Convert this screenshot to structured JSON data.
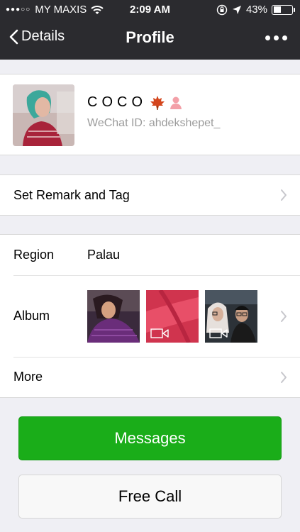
{
  "status": {
    "signal": "●●●○○",
    "carrier": "MY MAXIS",
    "time": "2:09 AM",
    "battery_text": "43%",
    "battery_level": 0.43
  },
  "nav": {
    "back_label": "Details",
    "title": "Profile"
  },
  "profile": {
    "name": "COCO",
    "wechat_id": "WeChat ID: ahdekshepet_"
  },
  "remark": {
    "label": "Set Remark and Tag"
  },
  "info": {
    "region_label": "Region",
    "region_value": "Palau",
    "album_label": "Album",
    "more_label": "More"
  },
  "actions": {
    "messages_label": "Messages",
    "call_label": "Free Call"
  },
  "colors": {
    "nav_bg": "#2b2b2f",
    "accent_green": "#1aad19",
    "page_bg": "#efeff4"
  },
  "icons": [
    "wifi-icon",
    "lock-rotation-icon",
    "location-arrow-icon",
    "battery-icon",
    "back-chevron-icon",
    "more-dots-icon",
    "maple-leaf-icon",
    "female-person-icon",
    "chevron-right-icon",
    "video-icon"
  ]
}
